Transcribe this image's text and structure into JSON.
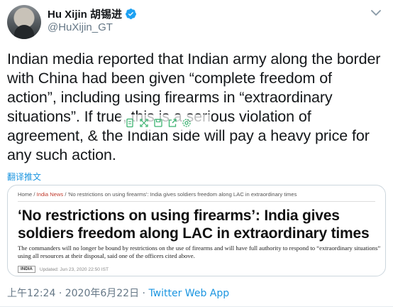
{
  "author": {
    "display_name": "Hu Xijin 胡锡进",
    "handle": "@HuXijin_GT",
    "verified": true
  },
  "tweet": {
    "text": "Indian media reported that Indian army along the border with China had been given “complete freedom of action”, including using firearms in “extraordinary situations”. If true, this is a serious violation of agreement, & the Indian side will pay a heavy price for any such action.",
    "translate_label": "翻译推文"
  },
  "overlay_toolbar": {
    "icons": [
      "copy-icon",
      "expand-icon",
      "save-icon",
      "share-icon",
      "settings-icon"
    ]
  },
  "media_card": {
    "breadcrumb_home": "Home",
    "breadcrumb_section": "India News",
    "breadcrumb_title": "'No restrictions on using firearms': India gives soldiers freedom along LAC in extraordinary times",
    "headline": "‘No restrictions on using firearms’: India gives soldiers freedom along LAC in extraordinary times",
    "summary": "The commanders will no longer be bound by restrictions on the use of firearms and will have full authority to respond to “extraordinary situations” using all resources at their disposal, said one of the officers cited above.",
    "tag": "INDIA",
    "updated": "Updated: Jun 23, 2020 22:50 IST"
  },
  "footer": {
    "time": "上午12:24",
    "date": "2020年6月22日",
    "separator": "·",
    "app": "Twitter Web App"
  },
  "colors": {
    "link_blue": "#1b95e0",
    "secondary_text": "#657786",
    "border": "#ccd6dd"
  }
}
